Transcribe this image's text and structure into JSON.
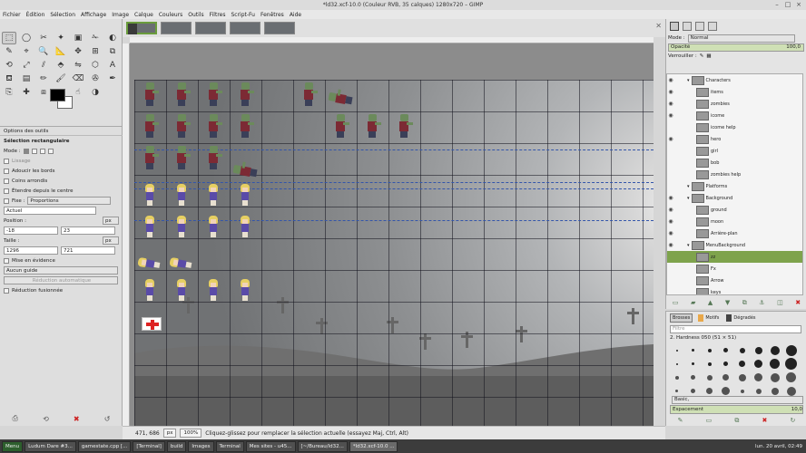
{
  "window": {
    "title": "*ld32.xcf-10.0 (Couleur RVB, 35 calques) 1280x720 – GIMP",
    "buttons": [
      "–",
      "□",
      "×"
    ]
  },
  "menu": [
    "Fichier",
    "Édition",
    "Sélection",
    "Affichage",
    "Image",
    "Calque",
    "Couleurs",
    "Outils",
    "Filtres",
    "Script-Fu",
    "Fenêtres",
    "Aide"
  ],
  "toolbox": {
    "tool_icons": [
      "rect-select-icon",
      "ellipse-select-icon",
      "free-select-icon",
      "fuzzy-select-icon",
      "color-select-icon",
      "scissors-icon",
      "foreground-select-icon",
      "paths-icon",
      "color-picker-icon",
      "zoom-icon",
      "measure-icon",
      "move-icon",
      "align-icon",
      "crop-icon",
      "rotate-icon",
      "scale-icon",
      "shear-icon",
      "perspective-icon",
      "flip-icon",
      "cage-icon",
      "text-icon",
      "bucket-fill-icon",
      "blend-icon",
      "pencil-icon",
      "paintbrush-icon",
      "eraser-icon",
      "airbrush-icon",
      "ink-icon",
      "clone-icon",
      "heal-icon",
      "perspective-clone-icon",
      "blur-icon",
      "smudge-icon",
      "dodge-icon"
    ],
    "tool_glyphs": [
      "⬚",
      "◯",
      "✂",
      "✦",
      "▣",
      "✁",
      "◐",
      "✎",
      "⌖",
      "🔍",
      "📐",
      "✥",
      "⊞",
      "⧉",
      "⟲",
      "⤢",
      "⫽",
      "⬘",
      "⇋",
      "⬡",
      "A",
      "⛾",
      "▤",
      "✏",
      "🖌",
      "⌫",
      "✇",
      "✒",
      "⎘",
      "✚",
      "⧈",
      "◌",
      "☝",
      "◑"
    ],
    "options_tab": "Options des outils",
    "section": "Sélection rectangulaire",
    "mode_label": "Mode :",
    "lissage": "Lissage",
    "adoucir": "Adoucir les bords",
    "coins": "Coins arrondis",
    "etendre": "Étendre depuis le centre",
    "fixe_label": "Fixe :",
    "fixe_value": "Proportions",
    "ratio_value": "Actuel",
    "position_label": "Position :",
    "position_unit": "px",
    "pos_x": "-18",
    "pos_y": "23",
    "taille_label": "Taille :",
    "taille_unit": "px",
    "size_w": "1296",
    "size_h": "721",
    "mise_en_evidence": "Mise en évidence",
    "guide_value": "Aucun guide",
    "reduction_auto": "Réduction automatique",
    "reduction_fusionnee": "Réduction fusionnée"
  },
  "statusbar": {
    "coords": "471, 686",
    "unit": "px",
    "zoom": "100%",
    "message": "Cliquez-glissez pour remplacer la sélection actuelle (essayez Maj, Ctrl, Alt)"
  },
  "layers_panel": {
    "mode_label": "Mode :",
    "mode_value": "Normal",
    "opacity_label": "Opacité",
    "opacity_value": "100,0",
    "lock_label": "Verrouiller :",
    "layers": [
      {
        "name": "Characters",
        "indent": 1,
        "eye": true,
        "group": true
      },
      {
        "name": "items",
        "indent": 2,
        "eye": true
      },
      {
        "name": "zombies",
        "indent": 2,
        "eye": true
      },
      {
        "name": "icome",
        "indent": 2,
        "eye": true
      },
      {
        "name": "icome help",
        "indent": 2,
        "eye": false
      },
      {
        "name": "hero",
        "indent": 2,
        "eye": true
      },
      {
        "name": "girl",
        "indent": 2,
        "eye": false
      },
      {
        "name": "bob",
        "indent": 2,
        "eye": false
      },
      {
        "name": "zombies help",
        "indent": 2,
        "eye": false
      },
      {
        "name": "Platforms",
        "indent": 1,
        "eye": false,
        "group": true
      },
      {
        "name": "Background",
        "indent": 1,
        "eye": true,
        "group": true
      },
      {
        "name": "ground",
        "indent": 2,
        "eye": true
      },
      {
        "name": "moon",
        "indent": 2,
        "eye": true
      },
      {
        "name": "Arrière-plan",
        "indent": 2,
        "eye": true
      },
      {
        "name": "MenuBackground",
        "indent": 1,
        "eye": true,
        "group": true
      },
      {
        "name": "zz",
        "indent": 2,
        "eye": false,
        "highlight": true
      },
      {
        "name": "Fx",
        "indent": 2,
        "eye": false
      },
      {
        "name": "Arrow",
        "indent": 2,
        "eye": false
      },
      {
        "name": "keys",
        "indent": 2,
        "eye": false
      }
    ]
  },
  "brushes_panel": {
    "tabs": [
      "Brosses",
      "Motifs",
      "Dégradés"
    ],
    "filter": "Filtre",
    "selected": "2. Hardness 050 (51 × 51)",
    "preset": "Basic,",
    "spacing_label": "Espacement",
    "spacing_value": "10,0"
  },
  "taskbar": {
    "menu": "Menu",
    "tasks": [
      "Ludum Dare #3...",
      "gamestate.cpp [...",
      "[Terminal]",
      "build",
      "Images",
      "Terminal",
      "Mes sites - u45...",
      "[~/Bureau/ld32...",
      "*ld32.xcf-10.0 ..."
    ],
    "clock": "lun. 20 avril, 02:49"
  }
}
